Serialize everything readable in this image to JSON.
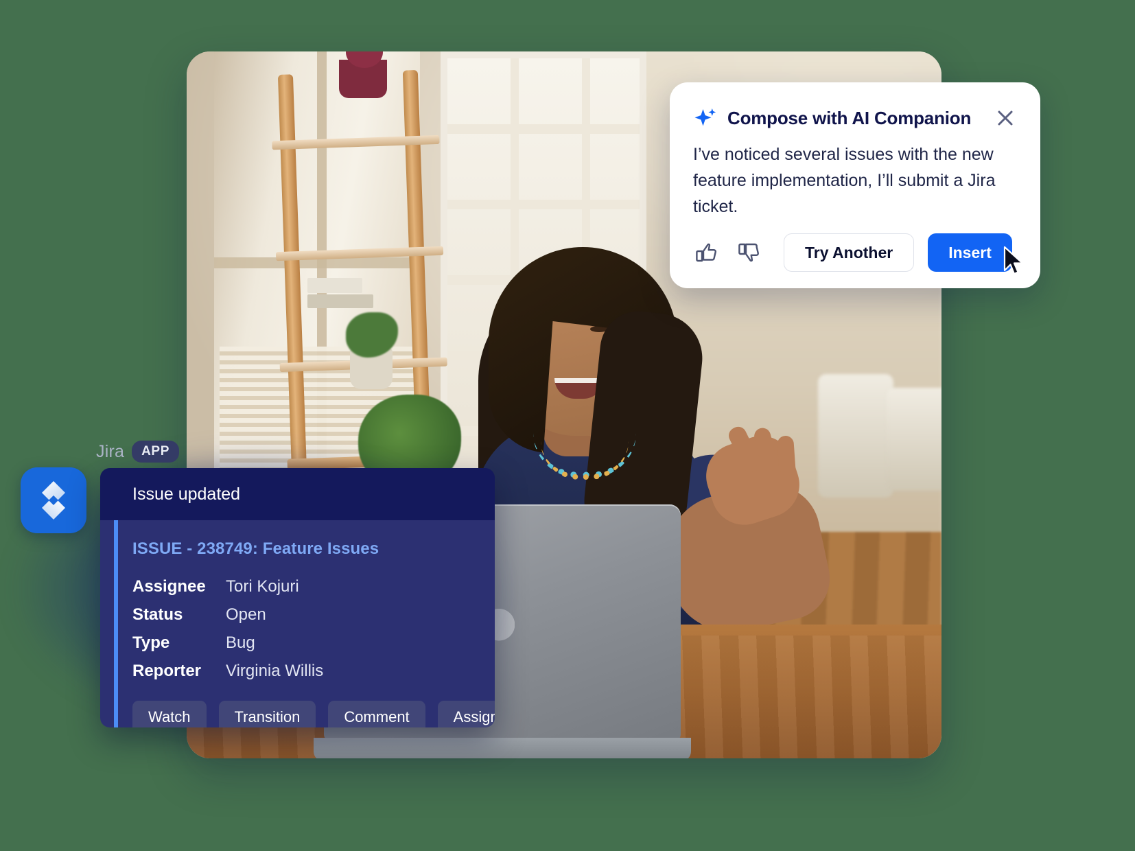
{
  "page": {
    "background_color": "#44704E"
  },
  "photo": {
    "alt_description": "Woman smiling at a laptop on a wooden desk in a bright room"
  },
  "ai_panel": {
    "icon": "ai-sparkle-icon",
    "title": "Compose with AI Companion",
    "close_icon": "close-icon",
    "message": "I’ve noticed several issues with the new feature implementation, I’ll submit a Jira ticket.",
    "thumbs_up_icon": "thumbs-up-icon",
    "thumbs_down_icon": "thumbs-down-icon",
    "try_another_label": "Try Another",
    "insert_label": "Insert",
    "accent_color": "#1264F4",
    "title_color": "#10144B",
    "cursor_icon": "mouse-pointer-icon"
  },
  "jira": {
    "app_name": "Jira",
    "app_badge": "APP",
    "logo_icon": "jira-logo-icon",
    "logo_color": "#1868DB",
    "header": "Issue updated",
    "issue_title": "ISSUE - 238749: Feature Issues",
    "issue_title_color": "#7FA9F5",
    "accent_color": "#4C8DF6",
    "fields": [
      {
        "key": "Assignee",
        "value": "Tori Kojuri"
      },
      {
        "key": "Status",
        "value": "Open"
      },
      {
        "key": "Type",
        "value": "Bug"
      },
      {
        "key": "Reporter",
        "value": "Virginia Willis"
      }
    ],
    "actions": [
      "Watch",
      "Transition",
      "Comment",
      "Assign"
    ]
  }
}
